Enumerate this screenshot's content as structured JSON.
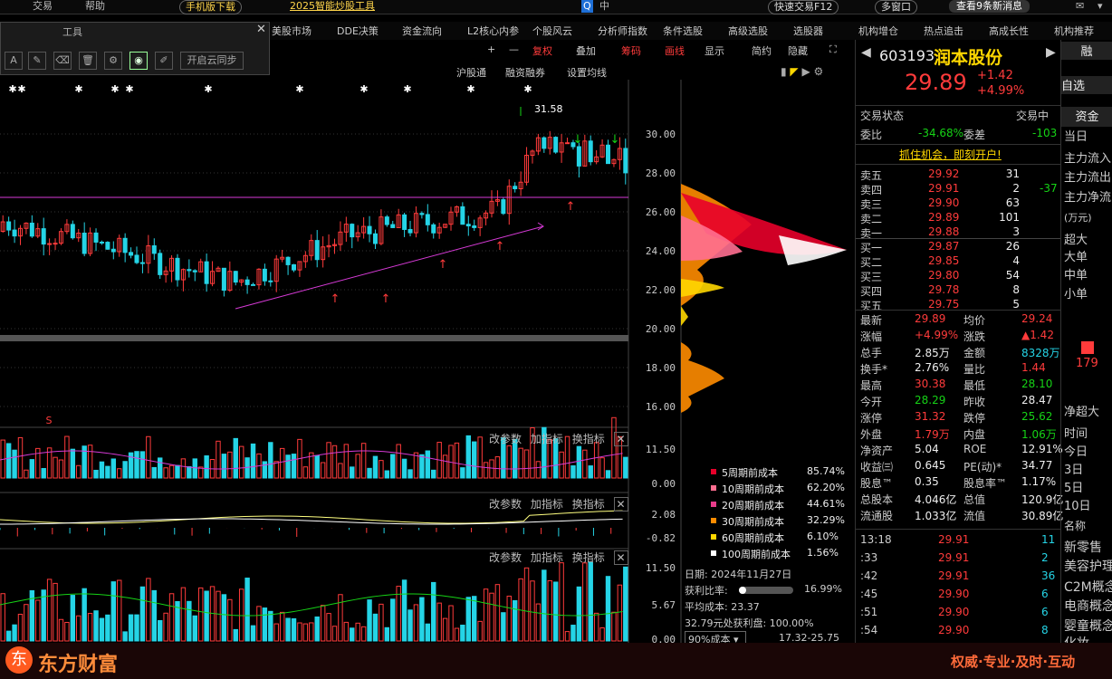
{
  "topbar": {
    "items": [
      "交易",
      "帮助",
      "手机版下载",
      "2025智能炒股工具",
      "中",
      "快速交易F12",
      "多窗口",
      "查看9条新消息"
    ]
  },
  "menubar": {
    "items": [
      "美股市场",
      "DDE决策",
      "资金流向",
      "L2核心内参",
      "个股风云",
      "分析师指数",
      "条件选股",
      "高级选股",
      "选股器",
      "机构增仓",
      "热点追击",
      "高成长性",
      "机构推荐"
    ]
  },
  "toolpanel": {
    "title": "工具",
    "cloud_sync": "开启云同步"
  },
  "chart_toolbar": {
    "items": [
      "+",
      "—",
      "复权",
      "叠加",
      "筹码",
      "画线",
      "显示",
      "简约",
      "隐藏"
    ]
  },
  "chart_sub": {
    "items": [
      "沪股通",
      "融资融券",
      "设置均线"
    ]
  },
  "indicator_controls": {
    "items": [
      "改参数",
      "加指标",
      "换指标"
    ]
  },
  "stock": {
    "code": "603193",
    "name": "润本股份",
    "price": "29.89",
    "change": "+1.42",
    "change_pct": "+4.99%",
    "btn1": "融",
    "btn2": "自选"
  },
  "trade_status": {
    "label": "交易状态",
    "value": "交易中",
    "weibi_label": "委比",
    "weibi": "-34.68%",
    "weicha_label": "委差",
    "weicha": "-103",
    "promo": "抓住机会，即刻开户!"
  },
  "asks": [
    {
      "label": "卖五",
      "price": "29.92",
      "vol": "31"
    },
    {
      "label": "卖四",
      "price": "29.91",
      "vol": "2",
      "extra": "-37"
    },
    {
      "label": "卖三",
      "price": "29.90",
      "vol": "63"
    },
    {
      "label": "卖二",
      "price": "29.89",
      "vol": "101"
    },
    {
      "label": "卖一",
      "price": "29.88",
      "vol": "3"
    }
  ],
  "bids": [
    {
      "label": "买一",
      "price": "29.87",
      "vol": "26"
    },
    {
      "label": "买二",
      "price": "29.85",
      "vol": "4"
    },
    {
      "label": "买三",
      "price": "29.80",
      "vol": "54"
    },
    {
      "label": "买四",
      "price": "29.78",
      "vol": "8"
    },
    {
      "label": "买五",
      "price": "29.75",
      "vol": "5"
    }
  ],
  "stats": [
    {
      "l1": "最新",
      "v1": "29.89",
      "l2": "均价",
      "v2": "29.24"
    },
    {
      "l1": "涨幅",
      "v1": "+4.99%",
      "l2": "涨跌",
      "v2": "▲1.42"
    },
    {
      "l1": "总手",
      "v1": "2.85万",
      "l2": "金额",
      "v2": "8328万"
    },
    {
      "l1": "换手*",
      "v1": "2.76%",
      "l2": "量比",
      "v2": "1.44"
    },
    {
      "l1": "最高",
      "v1": "30.38",
      "l2": "最低",
      "v2": "28.10"
    },
    {
      "l1": "今开",
      "v1": "28.29",
      "l2": "昨收",
      "v2": "28.47"
    },
    {
      "l1": "涨停",
      "v1": "31.32",
      "l2": "跌停",
      "v2": "25.62"
    },
    {
      "l1": "外盘",
      "v1": "1.79万",
      "l2": "内盘",
      "v2": "1.06万"
    },
    {
      "l1": "净资产",
      "v1": "5.04",
      "l2": "ROE",
      "v2": "12.91%"
    },
    {
      "l1": "收益㈢",
      "v1": "0.645",
      "l2": "PE(动)*",
      "v2": "34.77"
    },
    {
      "l1": "股息™",
      "v1": "0.35",
      "l2": "股息率™",
      "v2": "1.17%"
    },
    {
      "l1": "总股本",
      "v1": "4.046亿",
      "l2": "总值",
      "v2": "120.9亿"
    },
    {
      "l1": "流通股",
      "v1": "1.033亿",
      "l2": "流值",
      "v2": "30.89亿"
    }
  ],
  "ticks": [
    {
      "t": "13:18",
      "p": "29.91",
      "v": "11"
    },
    {
      "t": ":33",
      "p": "29.91",
      "v": "2"
    },
    {
      "t": ":42",
      "p": "29.91",
      "v": "36"
    },
    {
      "t": ":45",
      "p": "29.90",
      "v": "6"
    },
    {
      "t": ":51",
      "p": "29.90",
      "v": "6"
    },
    {
      "t": ":54",
      "p": "29.90",
      "v": "8"
    }
  ],
  "farright": {
    "items": [
      "资金",
      "当日",
      "主力流入",
      "主力流出",
      "主力净流",
      "(万元)",
      "超大",
      "大单",
      "中单",
      "小单",
      "179",
      "净超大",
      "时间",
      "今日",
      "3日",
      "5日",
      "10日",
      "名称",
      "新零售",
      "美容护理",
      "C2M概念",
      "电商概念",
      "婴童概念",
      "化妆"
    ]
  },
  "price_axis": [
    "30.00",
    "28.00",
    "26.00",
    "24.00",
    "22.00",
    "20.00",
    "18.00",
    "16.00"
  ],
  "vol_axis": [
    "11.50",
    "0.00"
  ],
  "ind2_axis": [
    "2.08",
    "-0.82"
  ],
  "ind3_axis": [
    "11.50",
    "5.67",
    "0.00"
  ],
  "peak_label": "31.58",
  "cost_legend": [
    {
      "name": "5周期前成本",
      "pct": "85.74%",
      "color": "#e8002a"
    },
    {
      "name": "10周期前成本",
      "pct": "62.20%",
      "color": "#ff6f91"
    },
    {
      "name": "20周期前成本",
      "pct": "44.61%",
      "color": "#e83c8a"
    },
    {
      "name": "30周期前成本",
      "pct": "32.29%",
      "color": "#ff8c00"
    },
    {
      "name": "60周期前成本",
      "pct": "6.10%",
      "color": "#ffd700"
    },
    {
      "name": "100周期前成本",
      "pct": "1.56%",
      "color": "#ffffff"
    }
  ],
  "chip_info": {
    "date": "日期: 2024年11月27日",
    "profit_label": "获利比率:",
    "profit": "16.99%",
    "avg": "平均成本: 23.37",
    "profit_at": "32.79元处获利盘: 100.00%",
    "range_sel": "90%成本",
    "range": "17.32-25.75"
  },
  "brand": {
    "name": "东方财富",
    "slogan": "权威·专业·及时·互动"
  },
  "chart_data": {
    "type": "candlestick",
    "ylim": [
      16,
      31.58
    ],
    "grid": true
  }
}
